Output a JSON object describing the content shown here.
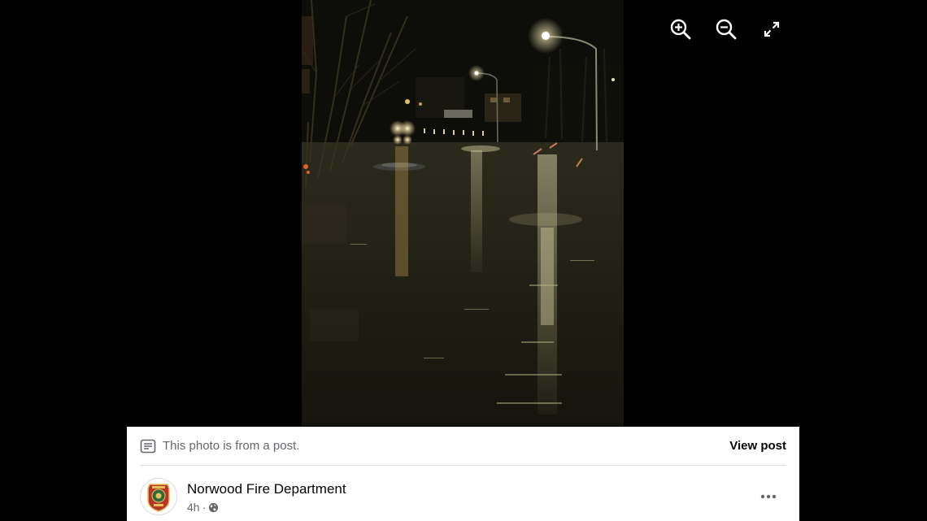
{
  "toolbar": {
    "zoom_in_icon": "zoom-in-icon",
    "zoom_out_icon": "zoom-out-icon",
    "fullscreen_icon": "fullscreen-icon"
  },
  "post_panel": {
    "notice": "This photo is from a post.",
    "notice_icon": "post-icon",
    "view_post_label": "View post",
    "author": {
      "name": "Norwood Fire Department",
      "time": "4h",
      "separator": "·",
      "privacy_icon": "globe-icon",
      "avatar_text_top": "NORWOOD",
      "avatar_text_bottom": "FIRE"
    },
    "more_icon": "more-options-icon"
  },
  "colors": {
    "background": "#000000",
    "panel": "#ffffff",
    "secondary_text": "#65676b",
    "primary_text": "#050505"
  }
}
